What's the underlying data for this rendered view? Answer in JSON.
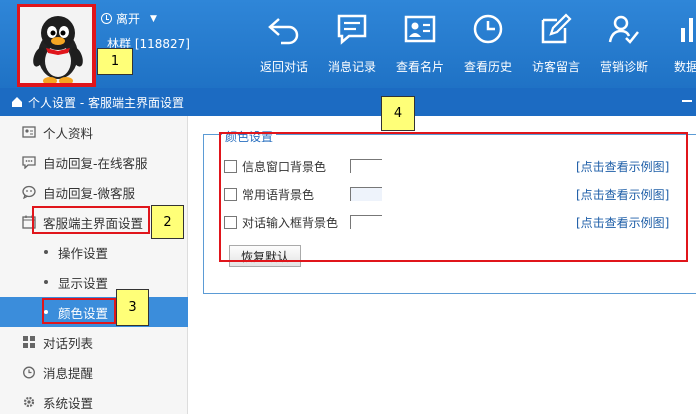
{
  "topbar": {
    "status_label": "离开",
    "username": "林群 [118827]",
    "tools": [
      {
        "label": "返回对话",
        "icon": "return-arrow-icon"
      },
      {
        "label": "消息记录",
        "icon": "message-record-icon"
      },
      {
        "label": "查看名片",
        "icon": "contact-card-icon"
      },
      {
        "label": "查看历史",
        "icon": "history-clock-icon"
      },
      {
        "label": "访客留言",
        "icon": "visitor-message-icon"
      },
      {
        "label": "营销诊断",
        "icon": "marketing-diagnosis-icon"
      },
      {
        "label": "数据统",
        "icon": "data-stats-icon"
      }
    ]
  },
  "titlebar": {
    "text": "个人设置 - 客服端主界面设置"
  },
  "sidebar": {
    "items": [
      {
        "label": "个人资料",
        "icon": "profile-card-icon"
      },
      {
        "label": "自动回复-在线客服",
        "icon": "chat-bubble-icon"
      },
      {
        "label": "自动回复-微客服",
        "icon": "wechat-icon"
      },
      {
        "label": "客服端主界面设置",
        "icon": "calendar-icon"
      },
      {
        "label": "操作设置"
      },
      {
        "label": "显示设置"
      },
      {
        "label": "颜色设置"
      },
      {
        "label": "对话列表",
        "icon": "list-icon"
      },
      {
        "label": "消息提醒",
        "icon": "alarm-clock-icon"
      },
      {
        "label": "系统设置",
        "icon": "gear-icon"
      }
    ]
  },
  "color_settings": {
    "legend": "颜色设置",
    "rows": [
      {
        "label": "信息窗口背景色",
        "link": "[点击查看示例图]",
        "swatch_color": "#ffffff"
      },
      {
        "label": "常用语背景色",
        "link": "[点击查看示例图]",
        "swatch_color": "#eef3fb"
      },
      {
        "label": "对话输入框背景色",
        "link": "[点击查看示例图]",
        "swatch_color": "#ffffff"
      }
    ],
    "reset_button": "恢复默认"
  },
  "annotations": [
    "1",
    "2",
    "3",
    "4"
  ],
  "colors": {
    "brand_blue": "#1f72c5",
    "active_item": "#3b8ddb",
    "annotation_red": "#e0151b",
    "callout_yellow": "#ffff78"
  }
}
